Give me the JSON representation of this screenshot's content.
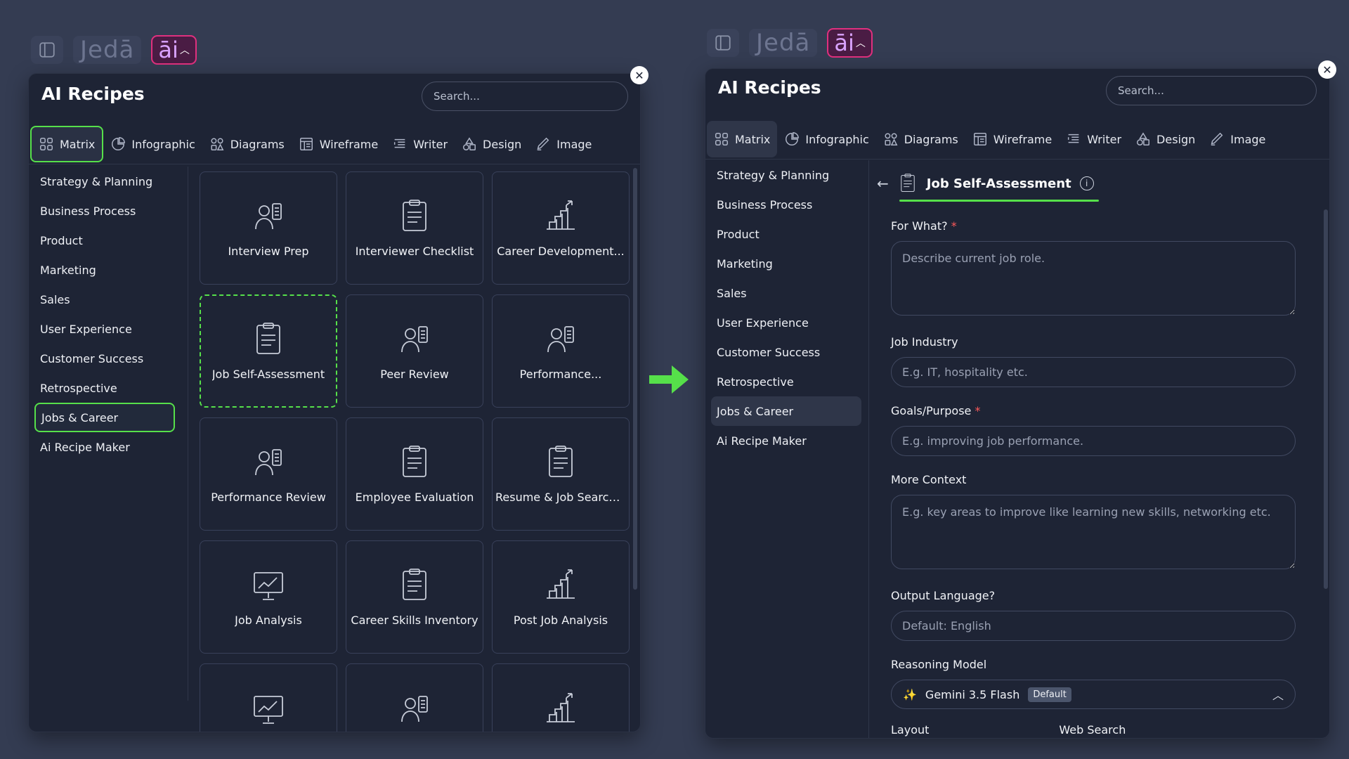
{
  "toolbar": {
    "logo": "Jedā",
    "ai_label": "āi",
    "ai_chevron": "^"
  },
  "left": {
    "title": "AI Recipes",
    "search_placeholder": "Search...",
    "close": "✕",
    "tabs": [
      "Matrix",
      "Infographic",
      "Diagrams",
      "Wireframe",
      "Writer",
      "Design",
      "Image"
    ],
    "sidebar": [
      "Strategy & Planning",
      "Business Process",
      "Product",
      "Marketing",
      "Sales",
      "User Experience",
      "Customer Success",
      "Retrospective",
      "Jobs & Career",
      "Ai Recipe Maker"
    ],
    "cards": [
      {
        "label": "Interview Prep",
        "icon": "interview-icon"
      },
      {
        "label": "Interviewer Checklist",
        "icon": "checklist-icon"
      },
      {
        "label": "Career Development...",
        "icon": "stairs-growth-icon"
      },
      {
        "label": "Job Self-Assessment",
        "icon": "clipboard-check-icon"
      },
      {
        "label": "Peer Review",
        "icon": "peer-review-icon"
      },
      {
        "label": "Performance...",
        "icon": "rating-person-icon"
      },
      {
        "label": "Performance Review",
        "icon": "performance-review-icon"
      },
      {
        "label": "Employee Evaluation",
        "icon": "evaluation-clipboard-icon"
      },
      {
        "label": "Resume & Job Search...",
        "icon": "resume-icon"
      },
      {
        "label": "Job Analysis",
        "icon": "presentation-chart-icon"
      },
      {
        "label": "Career Skills Inventory",
        "icon": "skills-inventory-icon"
      },
      {
        "label": "Post Job Analysis",
        "icon": "analysis-hand-icon"
      },
      {
        "label": "",
        "icon": "board-team-icon"
      },
      {
        "label": "",
        "icon": "person-star-icon"
      },
      {
        "label": "",
        "icon": "tools-gear-icon"
      }
    ]
  },
  "right": {
    "title": "AI Recipes",
    "search_placeholder": "Search...",
    "close": "✕",
    "tabs": [
      "Matrix",
      "Infographic",
      "Diagrams",
      "Wireframe",
      "Writer",
      "Design",
      "Image"
    ],
    "sidebar": [
      "Strategy & Planning",
      "Business Process",
      "Product",
      "Marketing",
      "Sales",
      "User Experience",
      "Customer Success",
      "Retrospective",
      "Jobs & Career",
      "Ai Recipe Maker"
    ],
    "back": "←",
    "recipe_title": "Job Self-Assessment",
    "info": "i",
    "form": {
      "for_what_label": "For What?",
      "for_what_placeholder": "Describe current job role.",
      "industry_label": "Job Industry",
      "industry_placeholder": "E.g. IT, hospitality etc.",
      "goals_label": "Goals/Purpose",
      "goals_placeholder": "E.g. improving job performance.",
      "context_label": "More Context",
      "context_placeholder": "E.g. key areas to improve like learning new skills, networking etc.",
      "language_label": "Output Language?",
      "language_placeholder": "Default: English",
      "model_label": "Reasoning Model",
      "model_value": "Gemini 3.5 Flash",
      "model_badge": "Default",
      "layout_label": "Layout",
      "web_search_label": "Web Search",
      "required_mark": "*"
    }
  },
  "colors": {
    "accent_green": "#56e04a",
    "ai_border": "#e0307e",
    "bg": "#343c52",
    "panel": "#1e2435"
  }
}
